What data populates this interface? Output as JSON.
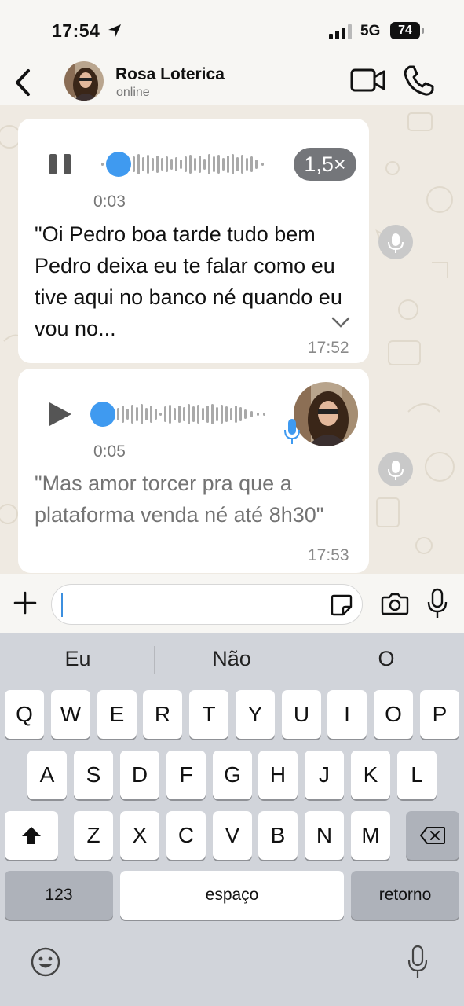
{
  "status_bar": {
    "time": "17:54",
    "network": "5G",
    "battery": "74"
  },
  "header": {
    "contact_name": "Rosa Loterica",
    "contact_status": "online",
    "icons": [
      "back-chevron-icon",
      "video-camera-icon",
      "phone-icon"
    ]
  },
  "messages": [
    {
      "type": "voice",
      "state": "playing",
      "duration": "0:03",
      "speed": "1,5×",
      "transcript": "\"Oi Pedro boa tarde tudo bem Pedro deixa eu te falar como eu tive aqui no banco né quando eu vou no...",
      "time": "17:52",
      "progress": 0.03
    },
    {
      "type": "voice",
      "state": "paused",
      "duration": "0:05",
      "transcript": "\"Mas amor torcer pra que a plataforma venda né até 8h30\"",
      "time": "17:53",
      "progress": 0.0
    }
  ],
  "input": {
    "value": "",
    "icons": [
      "plus-icon",
      "sticker-icon",
      "camera-icon",
      "microphone-icon"
    ]
  },
  "keyboard": {
    "suggestions": [
      "Eu",
      "Não",
      "O"
    ],
    "row1": [
      "Q",
      "W",
      "E",
      "R",
      "T",
      "Y",
      "U",
      "I",
      "O",
      "P"
    ],
    "row2": [
      "A",
      "S",
      "D",
      "F",
      "G",
      "H",
      "J",
      "K",
      "L"
    ],
    "row3": [
      "Z",
      "X",
      "C",
      "V",
      "B",
      "N",
      "M"
    ],
    "numbers_key": "123",
    "space_key": "espaço",
    "return_key": "retorno"
  },
  "colors": {
    "accent_blue": "#3f9af0",
    "chat_background": "#efeae2",
    "bubble": "#ffffff"
  }
}
